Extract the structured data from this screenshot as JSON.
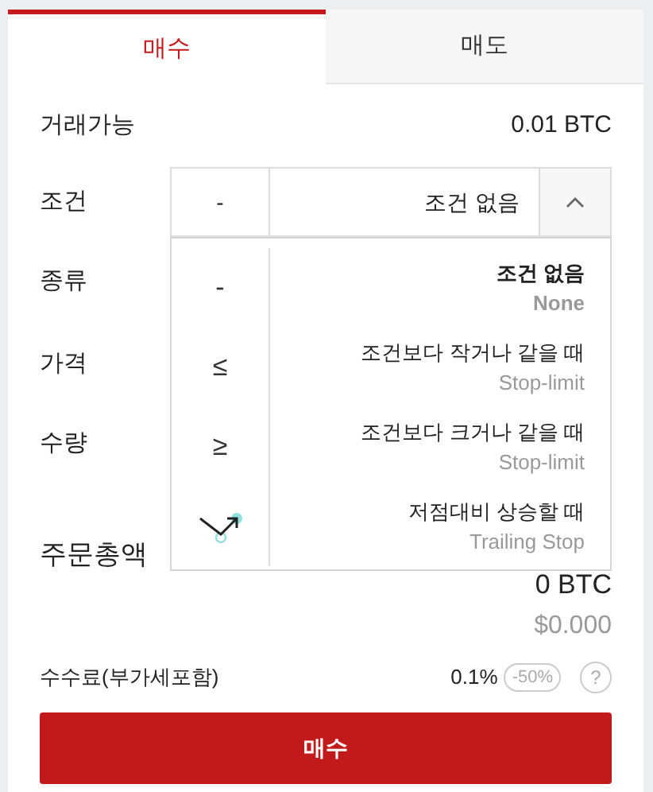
{
  "tabs": [
    {
      "label": "매수",
      "selected": true
    },
    {
      "label": "매도",
      "selected": false
    }
  ],
  "available": {
    "label": "거래가능",
    "value": "0.01 BTC"
  },
  "condition": {
    "label": "조건",
    "symbol": "-",
    "value": "조건 없음",
    "expanded": true
  },
  "condition_menu": [
    {
      "kind": "glyph",
      "symbol": "-",
      "title": "조건 없음",
      "subtitle": "None",
      "selected": true
    },
    {
      "kind": "glyph",
      "symbol": "≤",
      "title": "조건보다 작거나 같을 때",
      "subtitle": "Stop-limit",
      "selected": false
    },
    {
      "kind": "glyph",
      "symbol": "≥",
      "title": "조건보다 크거나 같을 때",
      "subtitle": "Stop-limit",
      "selected": false
    },
    {
      "kind": "trailing",
      "title": "저점대비 상승할 때",
      "subtitle": "Trailing Stop",
      "selected": false
    }
  ],
  "fields": [
    {
      "label": "종류"
    },
    {
      "label": "가격"
    },
    {
      "label": "수량"
    }
  ],
  "total": {
    "label": "주문총액",
    "value": "0 BTC",
    "usd": "$0.000"
  },
  "fee": {
    "label": "수수료(부가세포함)",
    "rate": "0.1%",
    "discount": "-50%",
    "help": "?"
  },
  "submit": {
    "label": "매수"
  }
}
